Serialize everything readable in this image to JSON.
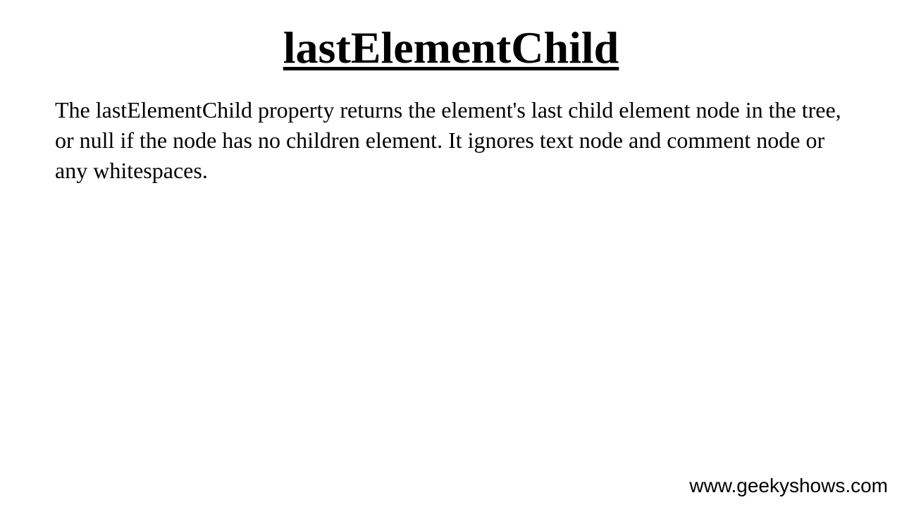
{
  "slide": {
    "title": "lastElementChild",
    "body": "The lastElementChild property returns the element's last child element node in the tree, or null if the node has no children element. It ignores text node and comment node or any whitespaces.",
    "footer_url": "www.geekyshows.com"
  }
}
